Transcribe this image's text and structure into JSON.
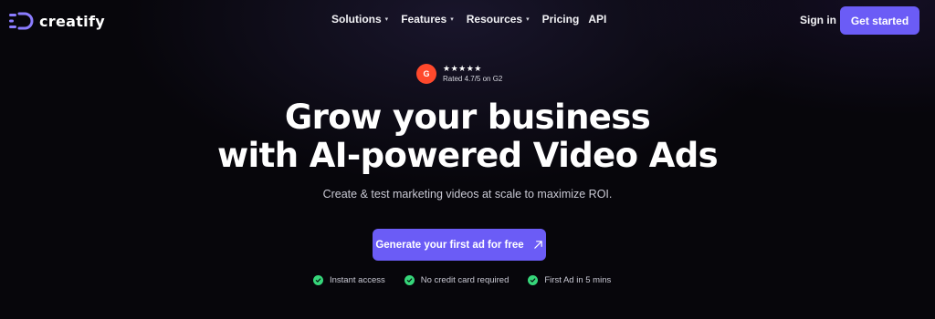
{
  "brand": {
    "name": "creatify",
    "accent": "#6b5cf6",
    "logo_icon": "creatify-logo-icon"
  },
  "nav": {
    "items": [
      {
        "label": "Solutions",
        "has_dropdown": true
      },
      {
        "label": "Features",
        "has_dropdown": true
      },
      {
        "label": "Resources",
        "has_dropdown": true
      },
      {
        "label": "Pricing",
        "has_dropdown": false
      },
      {
        "label": "API",
        "has_dropdown": false
      }
    ],
    "caret": "▾"
  },
  "header": {
    "signin_label": "Sign in",
    "cta_label": "Get started"
  },
  "rating": {
    "badge": "G",
    "stars": "★★★★★",
    "text": "Rated 4.7/5 on G2",
    "badge_color": "#ff492c"
  },
  "hero": {
    "headline_line1": "Grow your business",
    "headline_line2": "with AI-powered Video Ads",
    "subheadline": "Create & test marketing videos at scale to maximize ROI.",
    "cta_label": "Generate your first ad for free"
  },
  "features": [
    {
      "label": "Instant access"
    },
    {
      "label": "No credit card required"
    },
    {
      "label": "First Ad in 5 mins"
    }
  ],
  "colors": {
    "background": "#07060b",
    "check": "#36d67a"
  }
}
